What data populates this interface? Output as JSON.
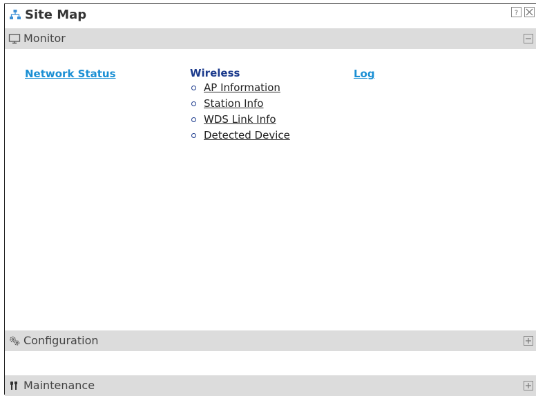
{
  "window": {
    "title": "Site Map",
    "title_icon": "site-map-icon",
    "help_icon": "help-icon",
    "close_icon": "close-icon"
  },
  "sections": {
    "monitor": {
      "label": "Monitor",
      "icon": "monitor-icon",
      "state": "expanded",
      "columns": {
        "network_status": {
          "label": "Network Status"
        },
        "wireless": {
          "label": "Wireless",
          "items": [
            "AP Information",
            "Station Info",
            "WDS Link Info",
            "Detected Device"
          ]
        },
        "log": {
          "label": "Log"
        }
      }
    },
    "configuration": {
      "label": "Configuration",
      "icon": "gear-icon",
      "state": "collapsed"
    },
    "maintenance": {
      "label": "Maintenance",
      "icon": "tools-icon",
      "state": "collapsed"
    }
  },
  "colors": {
    "link_blue": "#1a8fd4",
    "group_title_navy": "#1b3a8c",
    "header_gray": "#dcdcdc"
  }
}
